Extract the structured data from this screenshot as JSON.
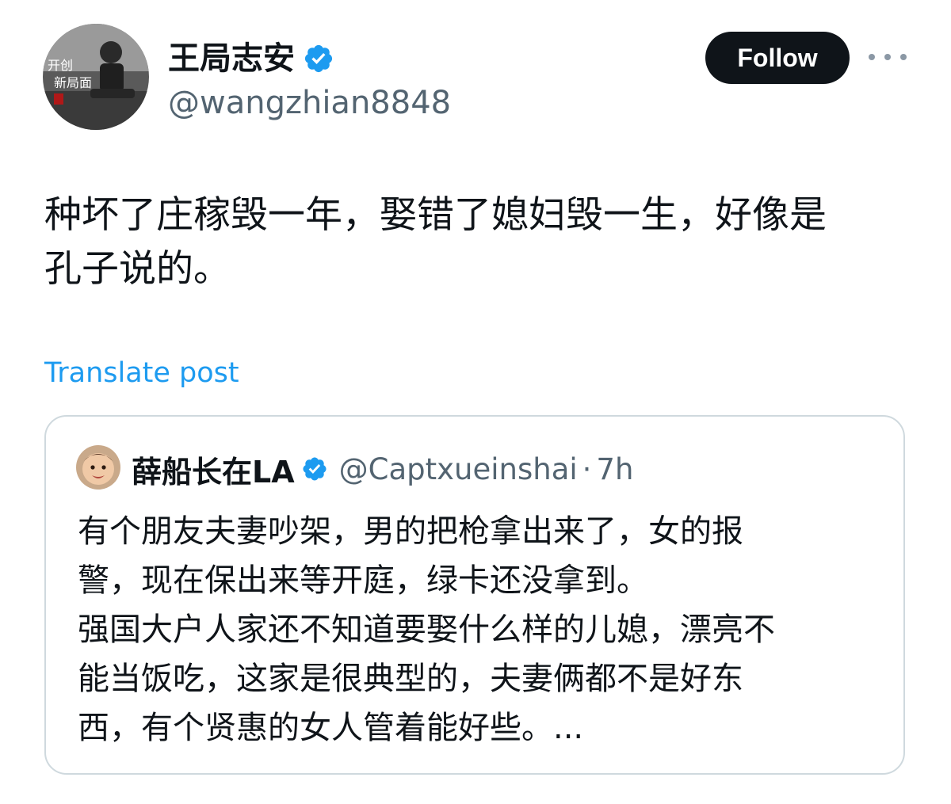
{
  "author": {
    "display_name": "王局志安",
    "handle": "@wangzhian8848",
    "avatar_icon": "profile-photo-avatar"
  },
  "follow_label": "Follow",
  "more_icon": "more-horizontal-icon",
  "post": {
    "text": "种坏了庄稼毁一年，娶错了媳妇毁一生，好像是\n孔子说的。"
  },
  "translate_label": "Translate post",
  "quote": {
    "display_name": "薛船长在LA",
    "handle": "@Captxueinshai",
    "separator": "·",
    "time": "7h",
    "text": "有个朋友夫妻吵架，男的把枪拿出来了，女的报\n警，现在保出来等开庭，绿卡还没拿到。\n强国大户人家还不知道要娶什么样的儿媳，漂亮不\n能当饭吃，这家是很典型的，夫妻俩都不是好东\n西，有个贤惠的女人管着能好些。..."
  },
  "colors": {
    "verified_badge": "#1d9bf0",
    "link": "#1d9bf0",
    "follow_bg": "#0f1419",
    "secondary_text": "#536471",
    "card_border": "#cfd9de"
  }
}
